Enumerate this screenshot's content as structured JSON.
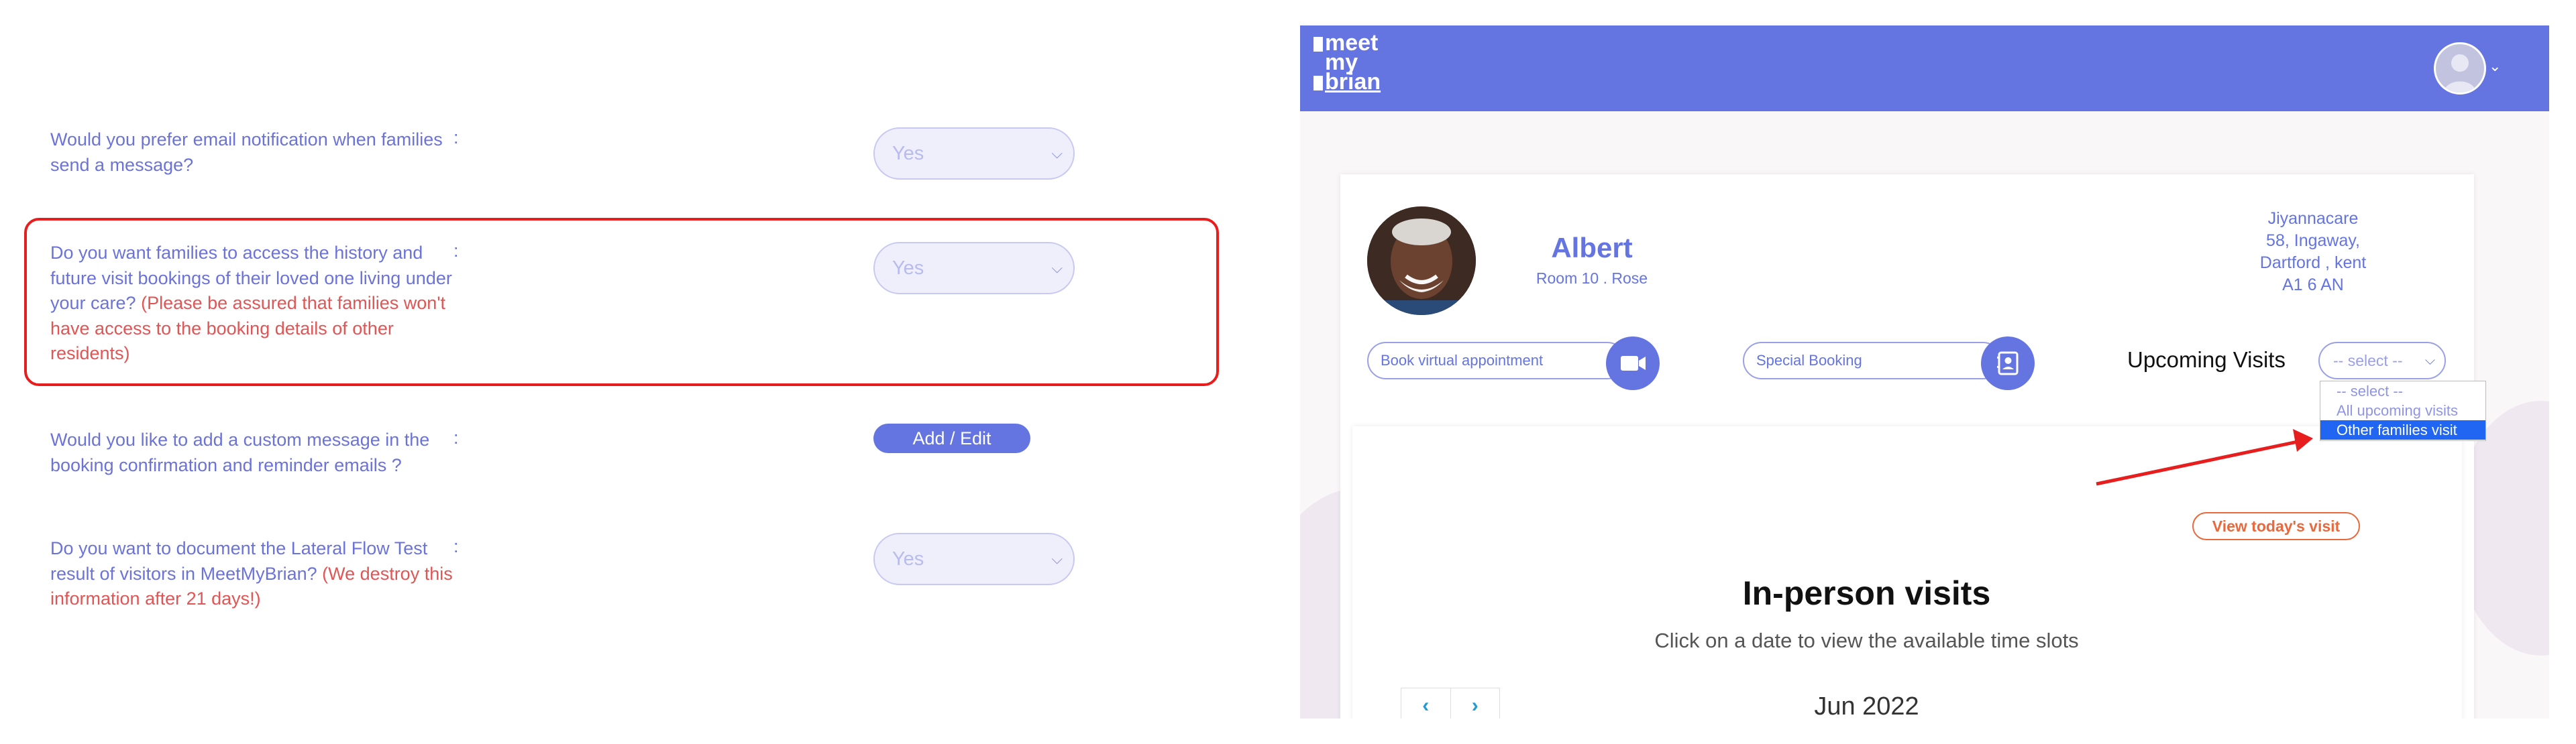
{
  "left_panel": {
    "questions": [
      {
        "text": "Would you prefer email notification when families send a message?",
        "control": "select",
        "value": "Yes"
      },
      {
        "text": "Do you want families to access the history and future visit bookings of their loved one living under your care?",
        "warning": "(Please be assured that families won't have access to the booking details of other residents)",
        "control": "select",
        "value": "Yes",
        "highlighted": true
      },
      {
        "text": "Would you like to add a custom message in the booking confirmation and reminder emails ?",
        "control": "button",
        "value": "Add / Edit"
      },
      {
        "text": "Do you want to document the Lateral Flow Test result of visitors in MeetMyBrian?",
        "warning": "(We destroy this information after 21 days!)",
        "control": "select",
        "value": "Yes"
      }
    ],
    "colon": ":"
  },
  "app": {
    "logo_lines": [
      "meet",
      "my",
      "brian"
    ],
    "colors": {
      "primary": "#6474e0",
      "accent": "#e9683c",
      "highlight": "#e61e1e"
    }
  },
  "resident": {
    "name": "Albert",
    "room": "Room 10 . Rose",
    "address_lines": [
      "Jiyannacare",
      "58, Ingaway,",
      "Dartford , kent",
      "A1 6 AN"
    ]
  },
  "actions": {
    "virtual": "Book virtual appointment",
    "special": "Special Booking"
  },
  "upcoming": {
    "label": "Upcoming Visits",
    "select_value": "-- select --",
    "options": [
      "-- select --",
      "All upcoming visits",
      "Other families visit"
    ],
    "selected_option": "Other families visit"
  },
  "visits": {
    "todays_button": "View today's visit",
    "title": "In-person visits",
    "subtitle": "Click on a date to view the available time slots",
    "prev": "‹",
    "next": "›",
    "month": "Jun 2022"
  }
}
